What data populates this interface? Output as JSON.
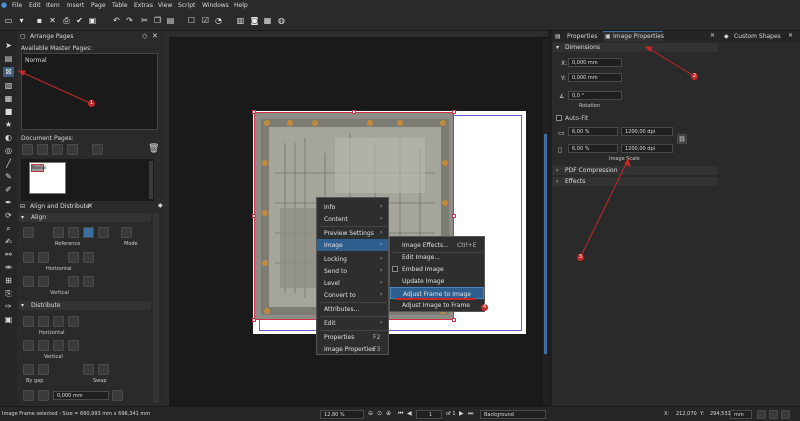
{
  "menubar": {
    "items": [
      "File",
      "Edit",
      "Item",
      "Insert",
      "Page",
      "Table",
      "Extras",
      "View",
      "Script",
      "Windows",
      "Help"
    ]
  },
  "arrange_pages": {
    "title": "Arrange Pages",
    "available_label": "Available Master Pages:",
    "master_page": "Normal",
    "document_pages_label": "Document Pages:",
    "thumb_label": "Normal"
  },
  "align": {
    "panel_title": "Align and Distribute",
    "align_section": "Align",
    "reference_label": "Reference",
    "mode_label": "Mode",
    "horizontal_label": "Horizontal",
    "vertical_label": "Vertical",
    "distribute_section": "Distribute",
    "dist_horizontal_label": "Horizontal",
    "dist_vertical_label": "Vertical",
    "by_gap_label": "By gap",
    "swap_label": "Swap",
    "gap_value": "0,000 mm"
  },
  "context_menu": {
    "items": [
      "Info",
      "Content",
      "Preview Settings",
      "Image",
      "Locking",
      "Send to",
      "Level",
      "Convert to",
      "Attributes...",
      "Edit",
      "Properties",
      "Image Properties"
    ],
    "shortcut_properties": "F2",
    "shortcut_image_properties": "F3"
  },
  "image_submenu": {
    "items": [
      "Image Effects...",
      "Edit Image...",
      "Embed Image",
      "Update Image",
      "Adjust Frame to Image",
      "Adjust Image to Frame"
    ],
    "shortcut_effects": "Ctrl+E"
  },
  "right_panel": {
    "tabs": [
      "Properties",
      "Image Properties",
      "Custom Shapes"
    ],
    "dimensions_label": "Dimensions",
    "x_label": "X:",
    "x_value": "0,000 mm",
    "y_label": "Y:",
    "y_value": "0,000 mm",
    "rotation_value": "0,0 °",
    "rotation_label": "Rotation",
    "autofit_label": "Auto-Fit",
    "scale_x_percent": "6,00 %",
    "scale_x_dpi": "1200,00 dpi",
    "scale_y_percent": "6,00 %",
    "scale_y_dpi": "1200,00 dpi",
    "image_scale_label": "Image Scale",
    "pdf_compression": "PDF Compression",
    "effects": "Effects"
  },
  "annotations": [
    "1",
    "2",
    "3",
    "4"
  ],
  "status": {
    "selection": "Image Frame selected : Size = 660,993 mm x 696,341 mm",
    "zoom": "12,80 %",
    "page_current": "1",
    "page_of": "of 1",
    "layer": "Background",
    "x_label": "X:",
    "x_value": "212,070",
    "y_label": "Y:",
    "y_value": "294,531",
    "unit": "mm"
  },
  "colors": {
    "accent": "#3d6e9e",
    "highlight": "#2f5f8f",
    "annotation": "#c62828",
    "frame_border": "#d0324a"
  }
}
